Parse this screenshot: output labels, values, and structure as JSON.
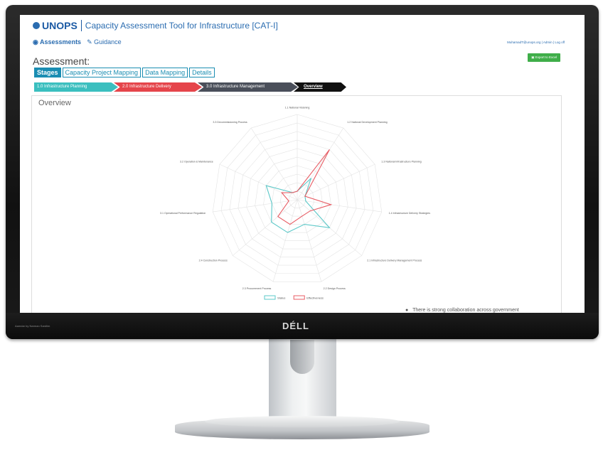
{
  "header": {
    "logo_text": "UNOPS",
    "app_title": "Capacity Assessment Tool for Infrastructure [CAT-I]"
  },
  "nav": {
    "assessments": "Assessments",
    "guidance": "Guidance"
  },
  "user_links": {
    "email": "MuhamadT@unops.org",
    "admin": "Admin",
    "logoff": "Log off"
  },
  "export_label": "Export to Excel",
  "assessment_label": "Assessment:",
  "tabs": [
    "Stages",
    "Capacity Project Mapping",
    "Data Mapping",
    "Details"
  ],
  "steps": [
    {
      "label": "1.0 Infrastructure Planning",
      "color": "#3bbfbf"
    },
    {
      "label": "2.0 Infrastructure Delivery",
      "color": "#e5454b"
    },
    {
      "label": "3.0 Infrastructure Management",
      "color": "#4a4f5a"
    },
    {
      "label": "Overview",
      "color": "#111111"
    }
  ],
  "overview_title": "Overview",
  "bullet_text": "There is strong collaboration across government",
  "monitor": {
    "brand": "DÉLL",
    "caption": "Aamdar by Narman Sardlim"
  },
  "chart_data": {
    "type": "radar",
    "axes": [
      "1.1 National Visioning",
      "1.2 National Development Planning",
      "1.3 National Infrastructure Planning",
      "1.4 Infrastructure Delivery Strategies",
      "2.1 Infrastructure Delivery Management Process",
      "2.2 Design Process",
      "2.3 Procurement Process",
      "2.4 Construction Process",
      "3.1 Operational Performance Regulation",
      "3.2 Operation & Maintenance",
      "3.3 Decommissioning Process"
    ],
    "rmax": 10,
    "series": [
      {
        "name": "Status",
        "color": "#5bc8c8",
        "values": [
          1,
          3,
          1,
          1,
          5,
          3,
          4,
          4,
          3,
          4,
          1
        ]
      },
      {
        "name": "Effectiveness",
        "color": "#e85c64",
        "values": [
          1,
          7,
          1,
          4,
          2,
          2,
          3,
          3,
          1,
          2,
          1
        ]
      }
    ],
    "legend_position": "bottom"
  }
}
